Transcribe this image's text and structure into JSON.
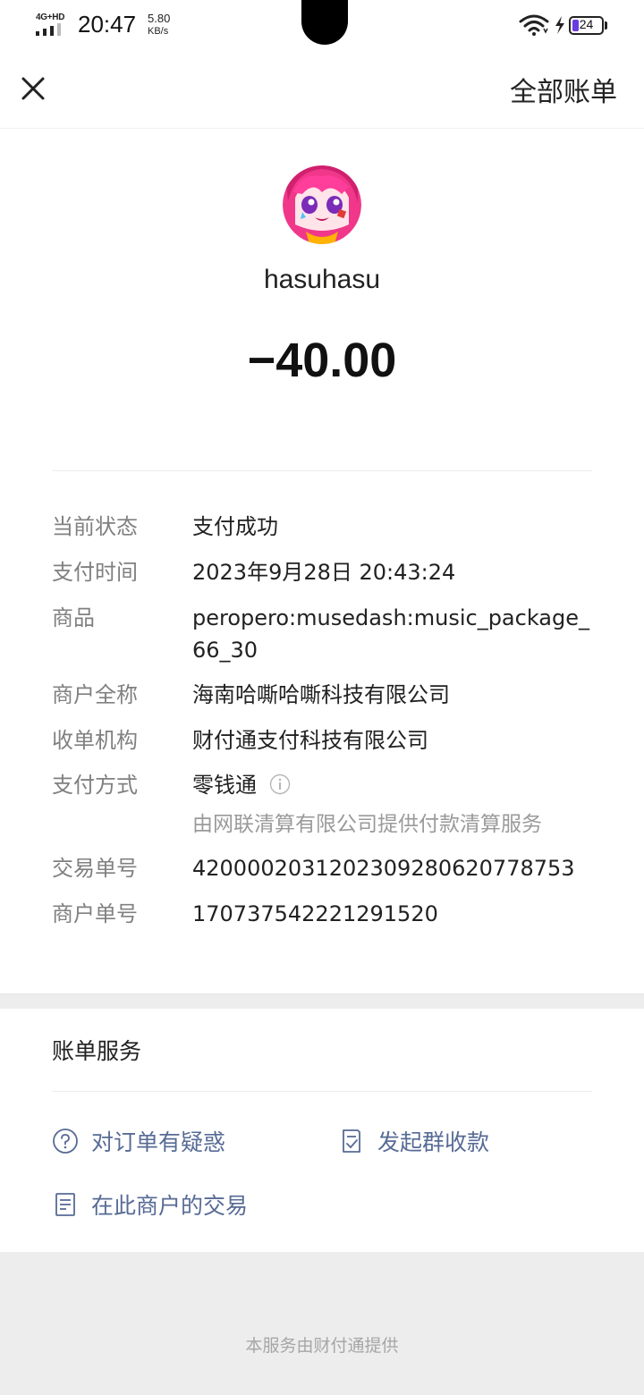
{
  "status_bar": {
    "network": "4G+HD",
    "time": "20:47",
    "speed_value": "5.80",
    "speed_unit": "KB/s",
    "battery_level": "24",
    "battery_fraction": 0.24,
    "battery_color": "#6a3be0"
  },
  "nav": {
    "close_icon": "close-icon",
    "right_label": "全部账单"
  },
  "summary": {
    "merchant_name": "hasuhasu",
    "amount": "−40.00"
  },
  "details": [
    {
      "label": "当前状态",
      "value": "支付成功"
    },
    {
      "label": "支付时间",
      "value": "2023年9月28日 20:43:24"
    },
    {
      "label": "商品",
      "value": "peropero:musedash:music_package_66_30"
    },
    {
      "label": "商户全称",
      "value": "海南哈嘶哈嘶科技有限公司"
    },
    {
      "label": "收单机构",
      "value": "财付通支付科技有限公司"
    },
    {
      "label": "支付方式",
      "value": "零钱通",
      "sub": "由网联清算有限公司提供付款清算服务"
    },
    {
      "label": "交易单号",
      "value": "4200002031202309280620778753"
    },
    {
      "label": "商户单号",
      "value": "170737542221291520"
    }
  ],
  "services": {
    "title": "账单服务",
    "links": [
      {
        "label": "对订单有疑惑",
        "icon": "question-circle-icon"
      },
      {
        "label": "发起群收款",
        "icon": "checklist-icon"
      },
      {
        "label": "在此商户的交易",
        "icon": "document-icon"
      }
    ],
    "link_color": "#576b95"
  },
  "footer": {
    "text": "本服务由财付通提供"
  }
}
